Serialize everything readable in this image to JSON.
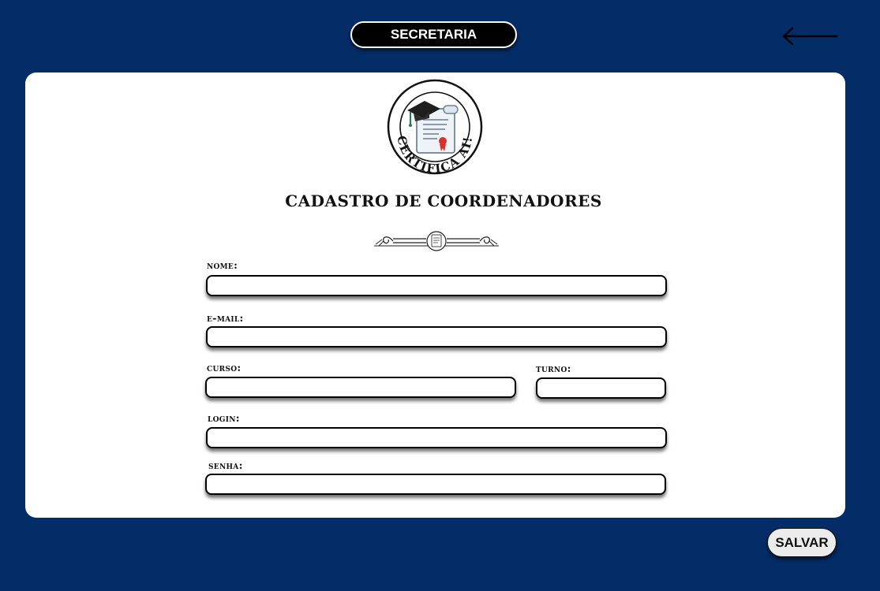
{
  "header": {
    "title": "SECRETARIA",
    "back_icon": "arrow-left-icon"
  },
  "logo": {
    "icon": "certificate-diploma-icon",
    "text": "CERTIFICA AI!"
  },
  "form": {
    "title": "CADASTRO DE COORDENADORES",
    "ornament_icon": "divider-ornament-icon",
    "fields": {
      "nome": {
        "label": "nome:",
        "value": ""
      },
      "email": {
        "label": "e-mail:",
        "value": ""
      },
      "curso": {
        "label": "curso:",
        "value": ""
      },
      "turno": {
        "label": "turno:",
        "value": ""
      },
      "login": {
        "label": "login:",
        "value": ""
      },
      "senha": {
        "label": "senha:",
        "value": ""
      }
    }
  },
  "actions": {
    "save_label": "SALVAR"
  },
  "colors": {
    "background": "#042C67",
    "card": "#FFFFFF",
    "pill": "#000000",
    "save_button": "#ECECEC"
  }
}
